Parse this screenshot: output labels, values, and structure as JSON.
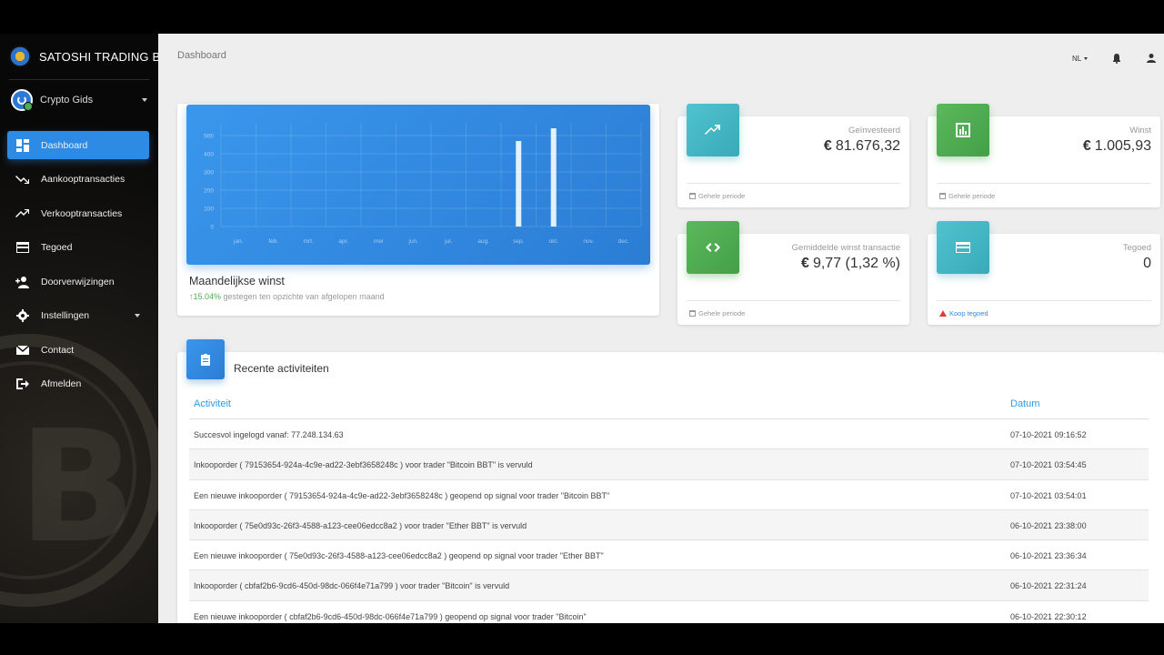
{
  "brand": {
    "name": "SATOSHI TRADING BOT"
  },
  "user": {
    "name": "Crypto Gids"
  },
  "nav": [
    {
      "label": "Dashboard",
      "icon": "dashboard-icon",
      "active": true
    },
    {
      "label": "Aankooptransacties",
      "icon": "trending-down-icon"
    },
    {
      "label": "Verkooptransacties",
      "icon": "trending-up-icon"
    },
    {
      "label": "Tegoed",
      "icon": "credit-card-icon"
    },
    {
      "label": "Doorverwijzingen",
      "icon": "person-add-icon"
    },
    {
      "label": "Instellingen",
      "icon": "gear-icon",
      "expandable": true
    },
    {
      "label": "Contact",
      "icon": "mail-icon"
    },
    {
      "label": "Afmelden",
      "icon": "logout-icon"
    }
  ],
  "header": {
    "breadcrumb": "Dashboard",
    "language": "NL"
  },
  "chart_card": {
    "title": "Maandelijkse winst",
    "change": "15.04%",
    "change_text": "gestegen ten opzichte van afgelopen maand"
  },
  "chart_data": {
    "type": "bar",
    "categories": [
      "jan.",
      "feb.",
      "mrt.",
      "apr.",
      "mei",
      "jun.",
      "jul.",
      "aug.",
      "sep.",
      "okt.",
      "nov.",
      "dec."
    ],
    "values": [
      0,
      0,
      0,
      0,
      0,
      0,
      0,
      0,
      470,
      540,
      0,
      0
    ],
    "yticks": [
      0,
      100,
      200,
      300,
      400,
      500
    ],
    "ylim": [
      0,
      550
    ],
    "grid": true
  },
  "stats": {
    "invested": {
      "label": "Geïnvesteerd",
      "currency": "€",
      "value": "81.676,32",
      "footer": "Gehele periode",
      "icon": "trending-up-icon"
    },
    "profit": {
      "label": "Winst",
      "currency": "€",
      "value": "1.005,93",
      "footer": "Gehele periode",
      "icon": "bar-chart-icon"
    },
    "avg": {
      "label": "Gemiddelde winst transactie",
      "currency": "€",
      "value": "9,77 (1,32 %)",
      "footer": "Gehele periode",
      "icon": "code-icon"
    },
    "credit": {
      "label": "Tegoed",
      "value": "0",
      "footer": "Koop tegoed",
      "icon": "credit-card-icon"
    }
  },
  "activities": {
    "title": "Recente activiteiten",
    "columns": [
      "Activiteit",
      "Datum"
    ],
    "rows": [
      [
        "Succesvol ingelogd vanaf: 77.248.134.63",
        "07-10-2021 09:16:52"
      ],
      [
        "Inkooporder ( 79153654-924a-4c9e-ad22-3ebf3658248c ) voor trader \"Bitcoin BBT\" is vervuld",
        "07-10-2021 03:54:45"
      ],
      [
        "Een nieuwe inkooporder ( 79153654-924a-4c9e-ad22-3ebf3658248c ) geopend op signal voor trader \"Bitcoin BBT\"",
        "07-10-2021 03:54:01"
      ],
      [
        "Inkooporder ( 75e0d93c-26f3-4588-a123-cee06edcc8a2 ) voor trader \"Ether BBT\" is vervuld",
        "06-10-2021 23:38:00"
      ],
      [
        "Een nieuwe inkooporder ( 75e0d93c-26f3-4588-a123-cee06edcc8a2 ) geopend op signal voor trader \"Ether BBT\"",
        "06-10-2021 23:36:34"
      ],
      [
        "Inkooporder ( cbfaf2b6-9cd6-450d-98dc-066f4e71a799 ) voor trader \"Bitcoin\" is vervuld",
        "06-10-2021 22:31:24"
      ],
      [
        "Een nieuwe inkooporder ( cbfaf2b6-9cd6-450d-98dc-066f4e71a799 ) geopend op signal voor trader \"Bitcoin\"",
        "06-10-2021 22:30:12"
      ]
    ]
  }
}
